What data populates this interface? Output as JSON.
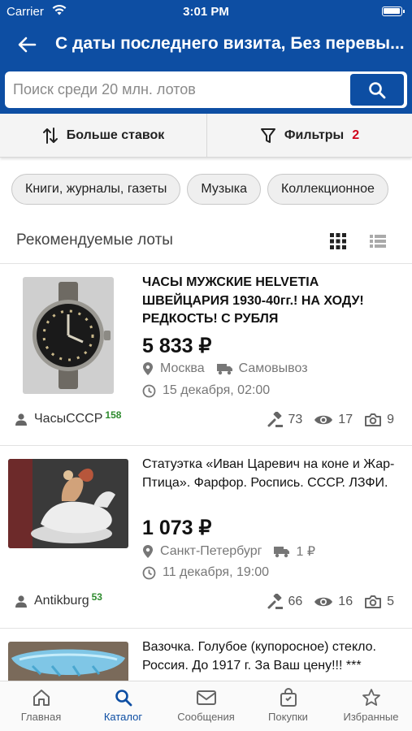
{
  "status_bar": {
    "carrier": "Carrier",
    "time": "3:01 PM"
  },
  "header": {
    "title": "С даты последнего визита, Без перевы..."
  },
  "search": {
    "placeholder": "Поиск среди 20 млн. лотов",
    "value": ""
  },
  "toolbar": {
    "sort_label": "Больше ставок",
    "filter_label": "Фильтры",
    "filter_count": "2"
  },
  "chips": [
    "Книги, журналы, газеты",
    "Музыка",
    "Коллекционное"
  ],
  "section": {
    "title": "Рекомендуемые лоты"
  },
  "lots": [
    {
      "title": "ЧАСЫ МУЖСКИЕ HELVETIA ШВЕЙЦАРИЯ 1930-40гг.! НА ХОДУ! РЕДКОСТЬ! С РУБЛЯ",
      "price": "5 833 ₽",
      "city": "Москва",
      "shipping": "Самовывоз",
      "date": "15 декабря, 02:00",
      "seller": "ЧасыСССР",
      "seller_rating": "158",
      "bids": "73",
      "views": "17",
      "photos": "9"
    },
    {
      "title": "Статуэтка «Иван Царевич на коне и Жар-Птица». Фарфор. Роспись. СССР. ЛЗФИ.",
      "price": "1 073 ₽",
      "city": "Санкт-Петербург",
      "shipping": "1 ₽",
      "date": "11 декабря, 19:00",
      "seller": "Antikburg",
      "seller_rating": "53",
      "bids": "66",
      "views": "16",
      "photos": "5"
    },
    {
      "title": "Вазочка. Голубое (купоросное) стекло. Россия. До 1917 г. За Ваш цену!!! ***"
    }
  ],
  "tabs": [
    {
      "label": "Главная",
      "icon": "home-icon"
    },
    {
      "label": "Каталог",
      "icon": "search-icon",
      "active": true
    },
    {
      "label": "Сообщения",
      "icon": "mail-icon"
    },
    {
      "label": "Покупки",
      "icon": "bag-icon"
    },
    {
      "label": "Избранные",
      "icon": "star-icon"
    }
  ],
  "colors": {
    "brand": "#0d4ea3",
    "filter_count": "#d0021b",
    "rating": "#2e8b2e"
  }
}
